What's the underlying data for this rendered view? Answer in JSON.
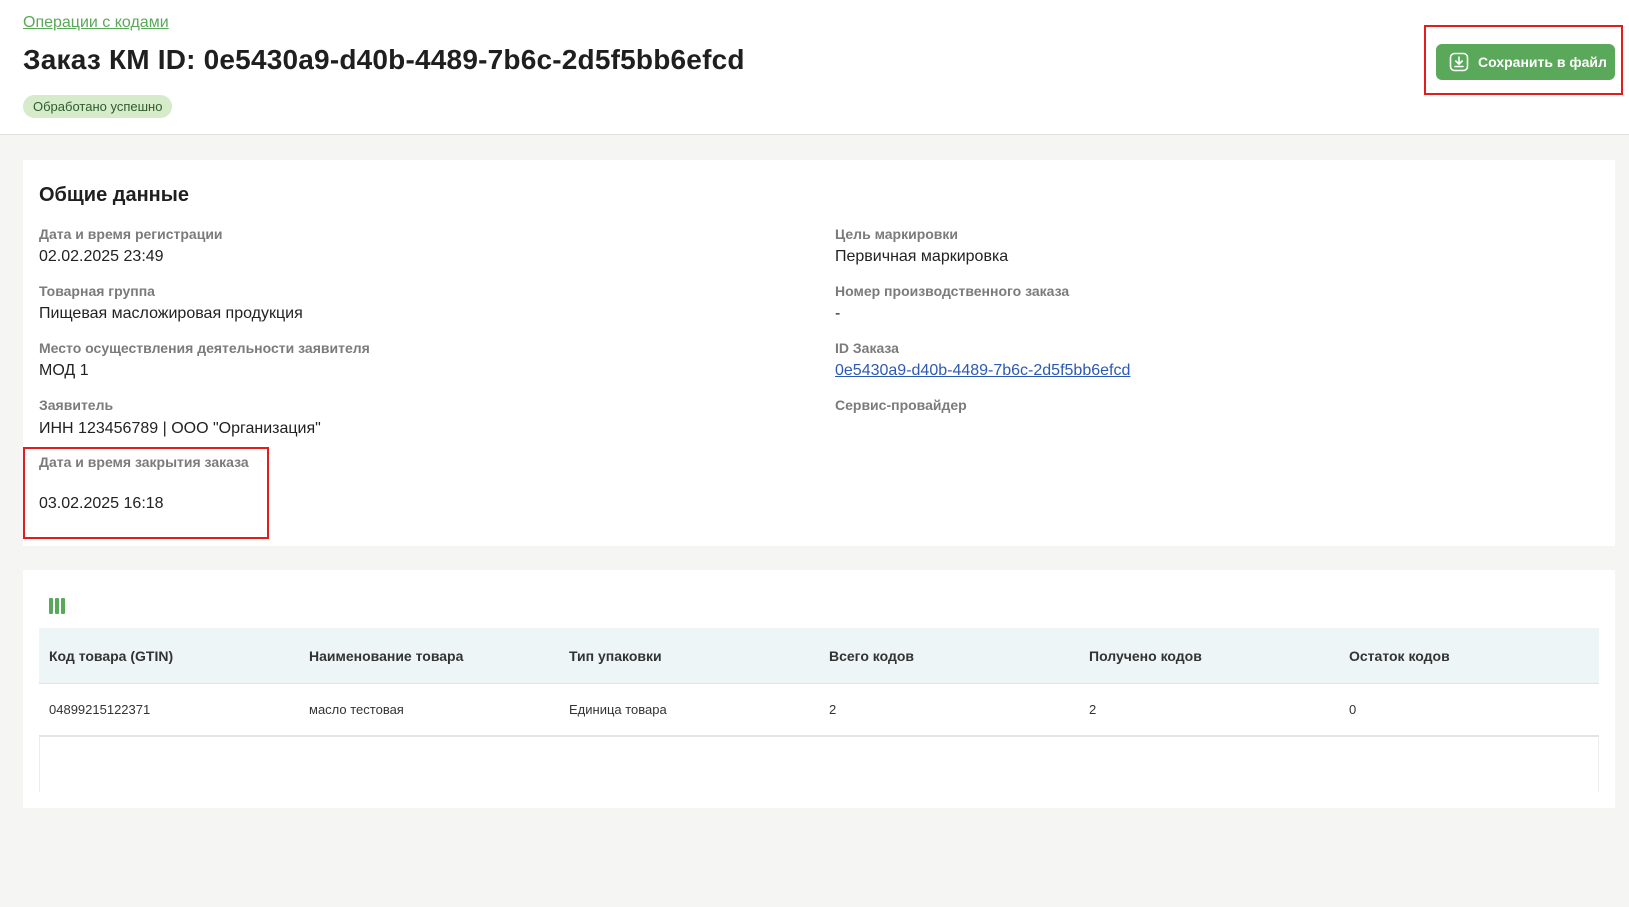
{
  "header": {
    "breadcrumb": "Операции с кодами",
    "title": "Заказ КМ ID: 0e5430a9-d40b-4489-7b6c-2d5f5bb6efcd",
    "status": "Обработано успешно",
    "save_label": "Сохранить в файл"
  },
  "general": {
    "title": "Общие данные",
    "left": [
      {
        "label": "Дата и время регистрации",
        "value": "02.02.2025 23:49"
      },
      {
        "label": "Товарная группа",
        "value": "Пищевая масложировая продукция"
      },
      {
        "label": "Место осуществления деятельности заявителя",
        "value": "МОД 1"
      },
      {
        "label": "Заявитель",
        "value": "ИНН 123456789 | ООО \"Организация\""
      },
      {
        "label": "Дата и время закрытия заказа",
        "value": "03.02.2025 16:18"
      }
    ],
    "right": [
      {
        "label": "Цель маркировки",
        "value": "Первичная маркировка"
      },
      {
        "label": "Номер производственного заказа",
        "value": "-"
      },
      {
        "label": "ID Заказа",
        "value": "0e5430a9-d40b-4489-7b6c-2d5f5bb6efcd"
      },
      {
        "label": "Сервис-провайдер",
        "value": ""
      }
    ]
  },
  "table": {
    "columns": [
      "Код товара (GTIN)",
      "Наименование товара",
      "Тип упаковки",
      "Всего кодов",
      "Получено кодов",
      "Остаток кодов"
    ],
    "rows": [
      [
        "04899215122371",
        "масло тестовая",
        "Единица товара",
        "2",
        "2",
        "0"
      ]
    ]
  },
  "colors": {
    "accent": "#5aa85a",
    "highlight": "#e31c1c",
    "link": "#2d59b3"
  },
  "icons": {
    "save": "download-icon",
    "columns": "columns-icon"
  }
}
